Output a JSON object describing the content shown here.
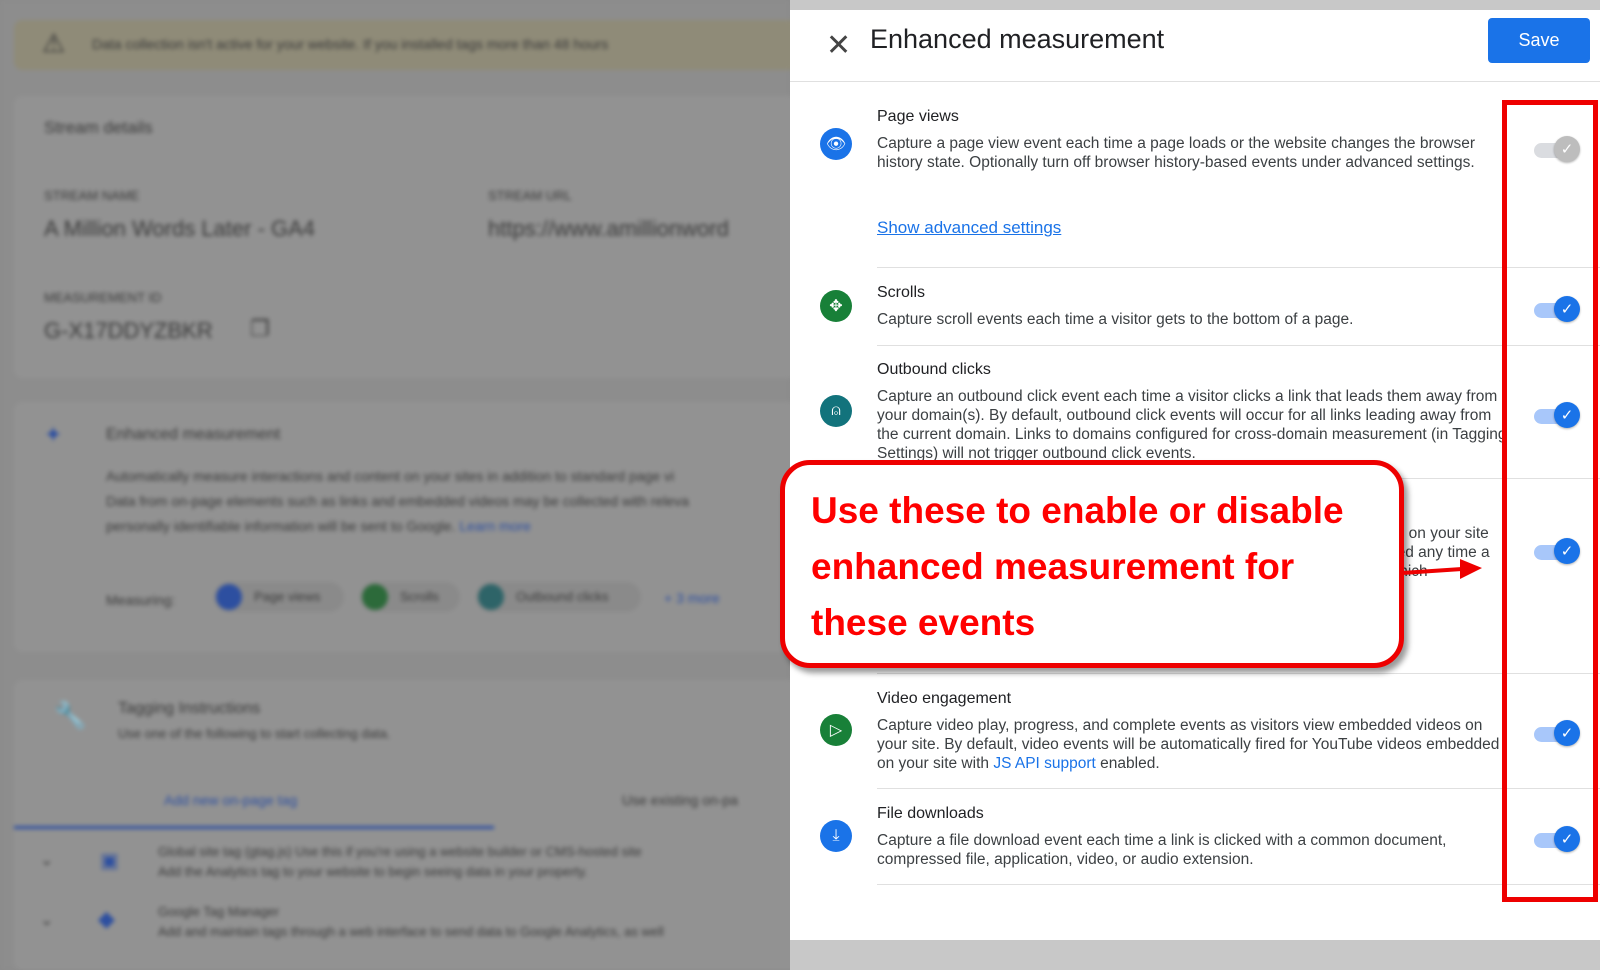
{
  "background": {
    "banner": "Data collection isn't active for your website. If you installed tags more than 48 hours",
    "stream_details": "Stream details",
    "stream_name_label": "STREAM NAME",
    "stream_name": "A Million Words Later - GA4",
    "stream_url_label": "STREAM URL",
    "stream_url": "https://www.amillionword",
    "measurement_id_label": "MEASUREMENT ID",
    "measurement_id": "G-X17DDYZBKR",
    "em_title": "Enhanced measurement",
    "em_desc": [
      "Automatically measure interactions and content on your sites in addition to standard page vi",
      "Data from on-page elements such as links and embedded videos may be collected with releva",
      "personally identifiable information will be sent to Google."
    ],
    "learn_more": "Learn more",
    "measuring_label": "Measuring:",
    "chips": [
      "Page views",
      "Scrolls",
      "Outbound clicks"
    ],
    "more": "+ 3 more",
    "tagging_title": "Tagging Instructions",
    "tagging_sub": "Use one of the following to start collecting data.",
    "tab_new": "Add new on-page tag",
    "tab_existing": "Use existing on-pa",
    "gtag_title": "Global site tag (gtag.js) Use this if you're using a website builder or CMS-hosted site",
    "gtag_sub": "Add the Analytics tag to your website to begin seeing data in your property.",
    "gtm_title": "Google Tag Manager",
    "gtm_sub": "Add and maintain tags through a web interface to send data to Google Analytics, as well"
  },
  "panel": {
    "title": "Enhanced measurement",
    "save": "Save",
    "rows": [
      {
        "title": "Page views",
        "desc": "Capture a page view event each time a page loads or the website changes the browser history state. Optionally turn off browser history-based events under advanced settings.",
        "link": "Show advanced settings",
        "enabled": true,
        "locked": true,
        "icon": "eye-icon",
        "color": "#1a73e8"
      },
      {
        "title": "Scrolls",
        "desc": "Capture scroll events each time a visitor gets to the bottom of a page.",
        "enabled": true,
        "icon": "scroll-icon",
        "color": "#188038"
      },
      {
        "title": "Outbound clicks",
        "desc": "Capture an outbound click event each time a visitor clicks a link that leads them away from your domain(s). By default, outbound click events will occur for all links leading away from the current domain. Links to domains configured for cross-domain measurement (in Tagging Settings) will not trigger outbound click events.",
        "enabled": true,
        "icon": "mouse-icon",
        "color": "#12737c"
      },
      {
        "fragments": [
          "ch on your site",
          "ired any time a",
          "which"
        ],
        "enabled": true
      },
      {
        "title": "Video engagement",
        "desc_pre": "Capture video play, progress, and complete events as visitors view embedded videos on your site. By default, video events will be automatically fired for YouTube videos embedded on your site with ",
        "link": "JS API support",
        "desc_post": " enabled.",
        "enabled": true,
        "icon": "play-icon",
        "color": "#188038"
      },
      {
        "title": "File downloads",
        "desc": "Capture a file download event each time a link is clicked with a common document, compressed file, application, video, or audio extension.",
        "enabled": true,
        "icon": "download-icon",
        "color": "#1a73e8"
      }
    ]
  },
  "annotation": {
    "callout": "Use these to enable or disable enhanced measurement for these events",
    "color": "#ff0000"
  }
}
